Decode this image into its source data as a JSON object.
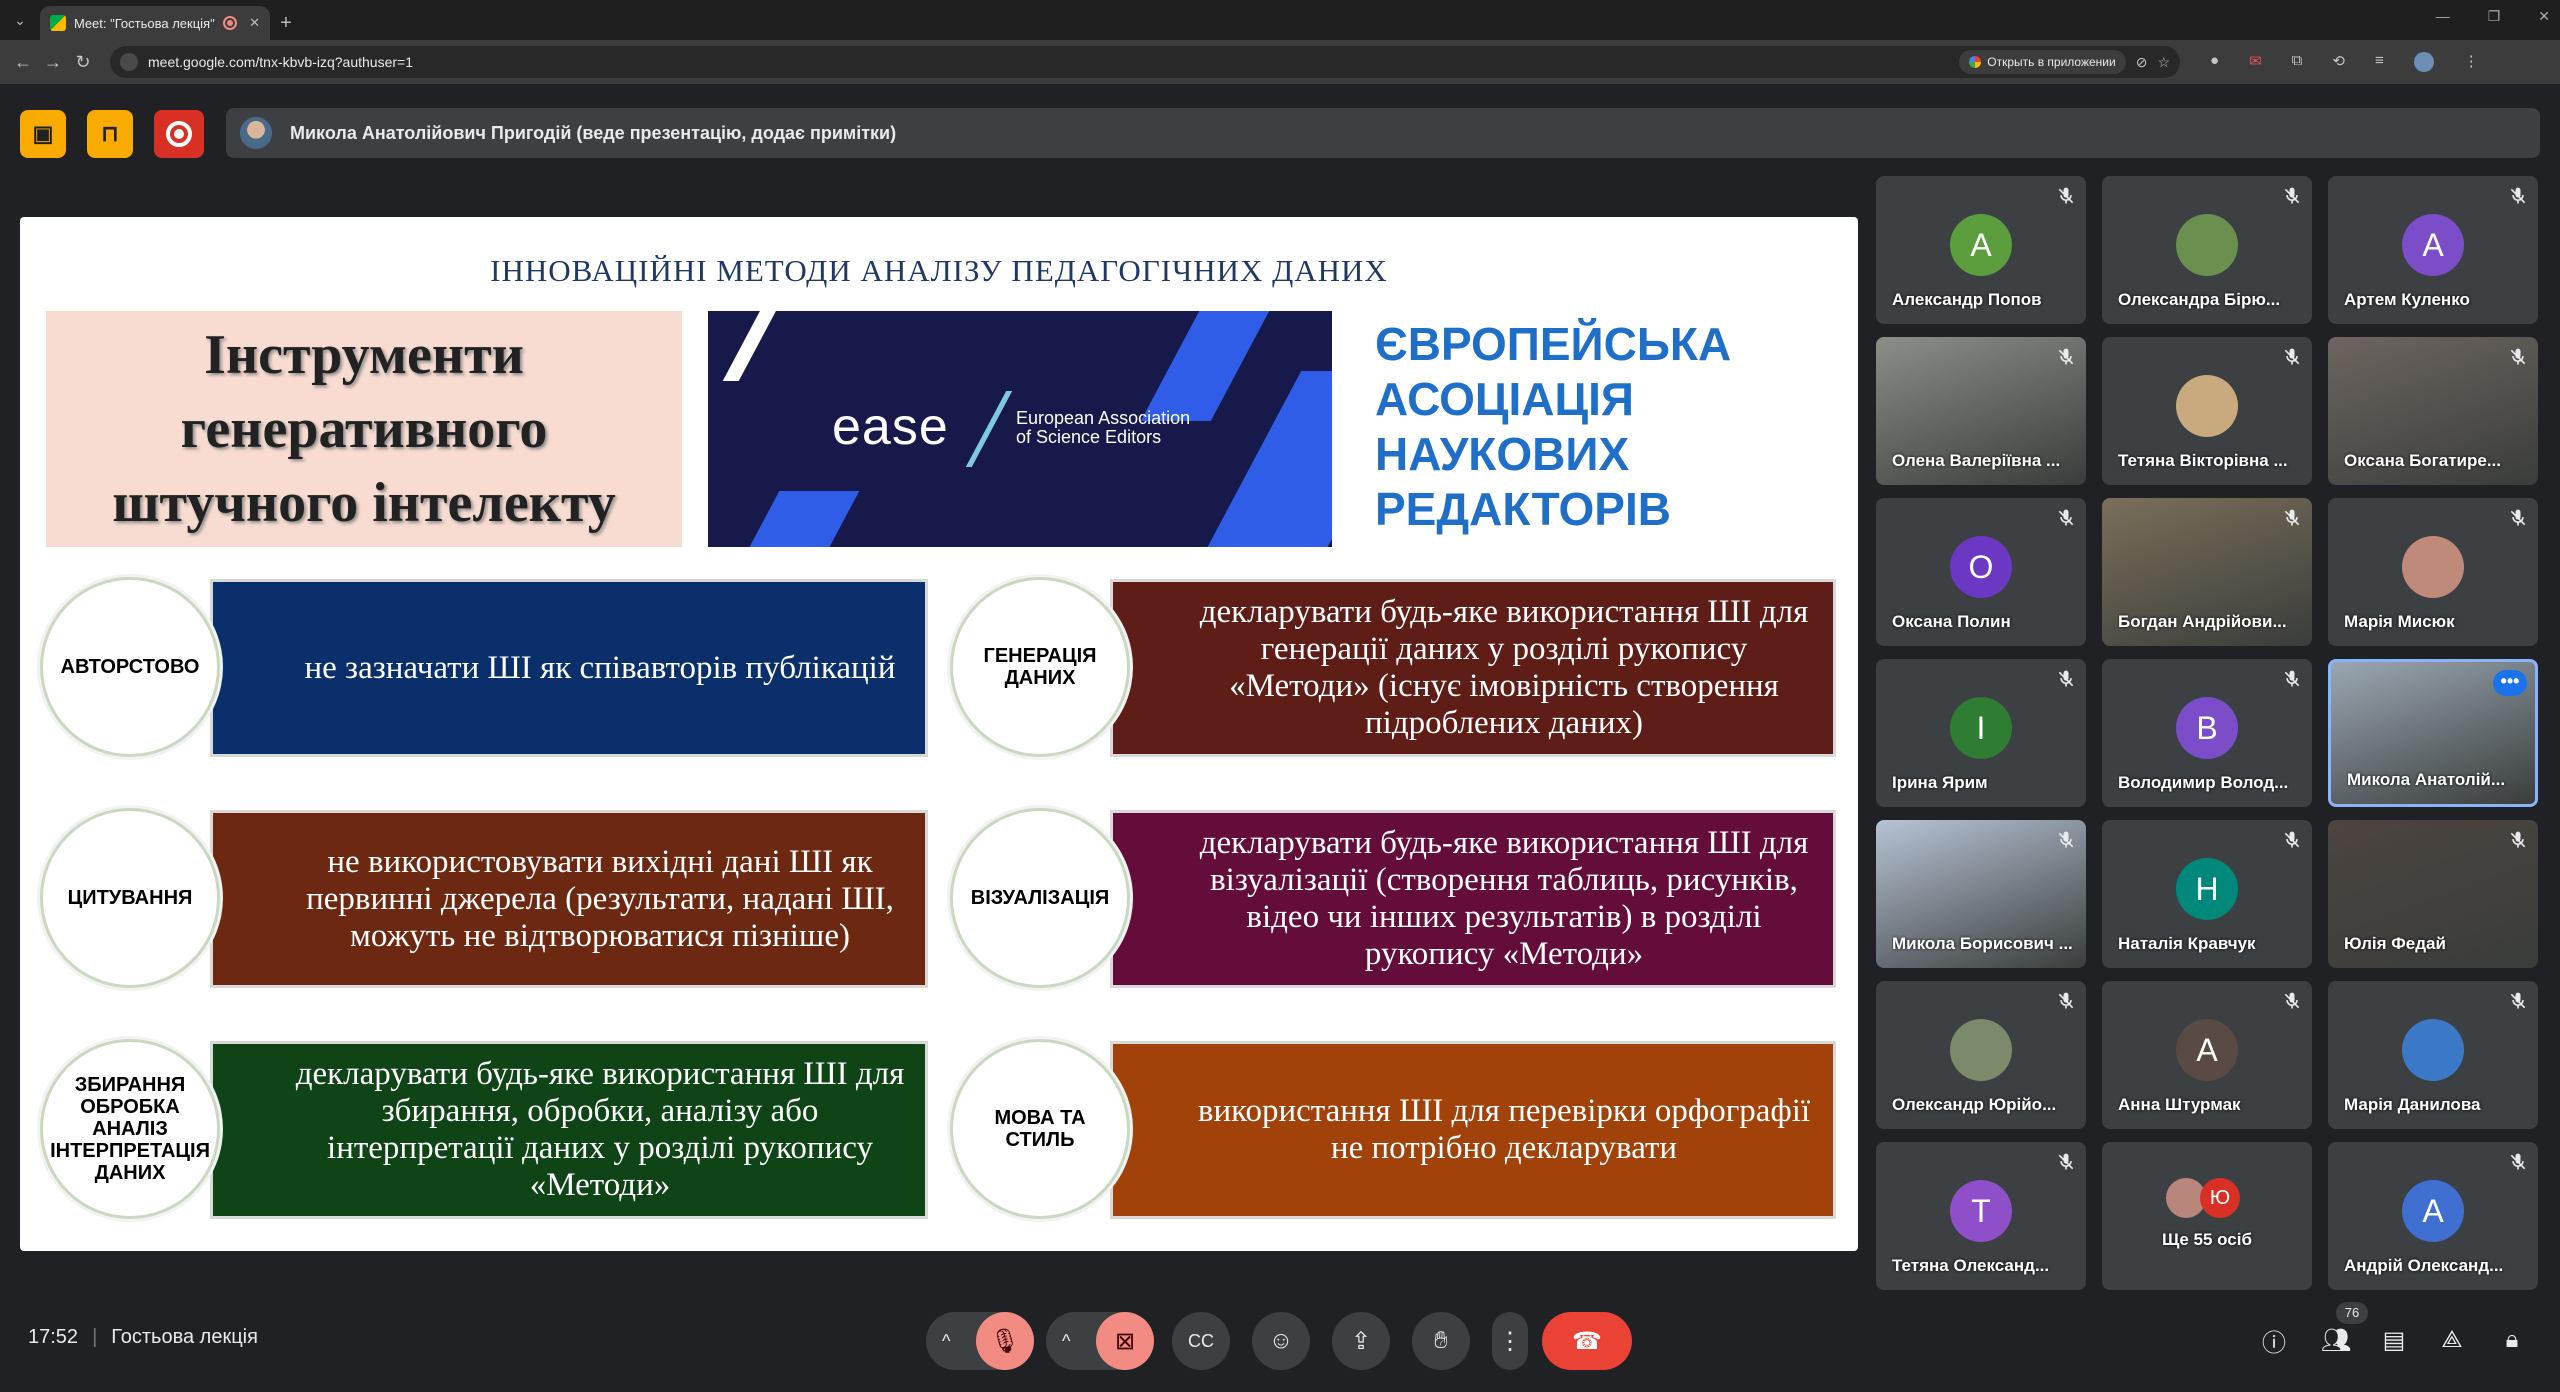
{
  "browser": {
    "tab_title": "Meet: \"Гостьова лекція\"",
    "url": "meet.google.com/tnx-kbvb-izq?authuser=1",
    "open_in_app": "Открыть в приложении"
  },
  "presenter_bar": {
    "text": "Микола Анатолійович Пригодій (веде презентацію, додає примітки)"
  },
  "slide": {
    "title": "ІННОВАЦІЙНІ МЕТОДИ АНАЛІЗУ ПЕДАГОГІЧНИХ ДАНИХ",
    "heading_lines": [
      "Інструменти",
      "генеративного",
      "штучного інтелекту"
    ],
    "logo_word": "ease",
    "logo_sub_lines": [
      "European Association",
      "of Science Editors"
    ],
    "association_lines": [
      "ЄВРОПЕЙСЬКА",
      "АСОЦІАЦІЯ",
      "НАУКОВИХ",
      "РЕДАКТОРІВ"
    ],
    "items": [
      {
        "label": "АВТОРСТОВО",
        "text": "не зазначати ШІ як співавторів публікацій",
        "color": "#0a2f6b"
      },
      {
        "label": "ГЕНЕРАЦІЯ ДАНИХ",
        "text": "декларувати будь-яке використання ШІ для генерації даних у розділі рукопису «Методи» (існує імовірність створення підроблених даних)",
        "color": "#5e1d17"
      },
      {
        "label": "ЦИТУВАННЯ",
        "text": "не використовувати вихідні дані ШІ як первинні джерела (результати, надані ШІ, можуть не відтворюватися пізніше)",
        "color": "#6d2812"
      },
      {
        "label": "ВІЗУАЛІЗАЦІЯ",
        "text": "декларувати будь-яке використання ШІ для візуалізації (створення таблиць, рисунків, відео чи інших результатів) в розділі рукопису «Методи»",
        "color": "#640c3a"
      },
      {
        "label": "ЗБИРАННЯ ОБРОБКА АНАЛІЗ ІНТЕРПРЕТАЦІЯ ДАНИХ",
        "text": "декларувати будь-яке використання ШІ для збирання, обробки, аналізу або інтерпретації даних у розділі рукопису «Методи»",
        "color": "#0f4516"
      },
      {
        "label": "МОВА ТА СТИЛЬ",
        "text": "використання ШІ для перевірки орфографії не потрібно декларувати",
        "color": "#a1420b"
      }
    ]
  },
  "participants": [
    {
      "name": "Александр Попов",
      "initial": "А",
      "color": "#5c9d3e",
      "type": "avatar"
    },
    {
      "name": "Олександра Бірю...",
      "initial": "",
      "color": "#6a8f4e",
      "type": "photo"
    },
    {
      "name": "Артем Куленко",
      "initial": "А",
      "color": "#7b4dc9",
      "type": "avatar"
    },
    {
      "name": "Олена Валеріївна ...",
      "initial": "",
      "color": "#8a8f88",
      "type": "camera"
    },
    {
      "name": "Тетяна Вікторівна ...",
      "initial": "",
      "color": "#c9a97e",
      "type": "photo"
    },
    {
      "name": "Оксана Богатире...",
      "initial": "",
      "color": "#6d6560",
      "type": "camera"
    },
    {
      "name": "Оксана Полин",
      "initial": "О",
      "color": "#6b38c4",
      "type": "avatar"
    },
    {
      "name": "Богдан Андрійови...",
      "initial": "",
      "color": "#7a6f5a",
      "type": "camera"
    },
    {
      "name": "Марія Мисюк",
      "initial": "",
      "color": "#c08a7a",
      "type": "photo"
    },
    {
      "name": "Ірина Ярим",
      "initial": "І",
      "color": "#2e7d32",
      "type": "avatar"
    },
    {
      "name": "Володимир Волод...",
      "initial": "В",
      "color": "#7b4dc9",
      "type": "avatar"
    },
    {
      "name": "Микола Анатолій...",
      "initial": "",
      "color": "#9aa7b3",
      "type": "camera"
    },
    {
      "name": "Микола Борисович ...",
      "initial": "",
      "color": "#b7c4d6",
      "type": "camera"
    },
    {
      "name": "Наталія Кравчук",
      "initial": "Н",
      "color": "#00897b",
      "type": "avatar"
    },
    {
      "name": "Юлія Федай",
      "initial": "",
      "color": "#4c4440",
      "type": "camera"
    },
    {
      "name": "Олександр Юрійо...",
      "initial": "",
      "color": "#7a8a6a",
      "type": "photo"
    },
    {
      "name": "Анна Штурмак",
      "initial": "А",
      "color": "#5a4a44",
      "type": "avatar"
    },
    {
      "name": "Марія Данилова",
      "initial": "",
      "color": "#3b79c7",
      "type": "photo"
    },
    {
      "name": "Тетяна Олександ...",
      "initial": "Т",
      "color": "#8e4fc9",
      "type": "avatar"
    },
    {
      "name": "Ще 55 осіб",
      "initial": "Ю",
      "color": "#d93025",
      "type": "others"
    },
    {
      "name": "Андрій Олександ...",
      "initial": "А",
      "color": "#3f6fd1",
      "type": "avatar"
    }
  ],
  "bottom": {
    "time": "17:52",
    "meeting_name": "Гостьова лекція",
    "participants_count": "76"
  }
}
